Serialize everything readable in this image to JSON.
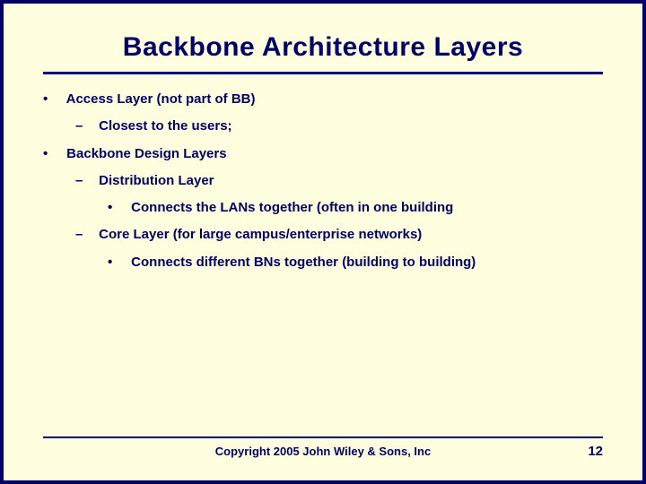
{
  "title": "Backbone Architecture Layers",
  "bullets": {
    "access_layer": "Access Layer (not part of BB)",
    "closest_users": "Closest to the users;",
    "backbone_design": "Backbone Design Layers",
    "dist_layer": "Distribution Layer",
    "connects_lans": "Connects the LANs together (often in one building",
    "core_layer": "Core Layer (for large campus/enterprise networks)",
    "connects_bns": "Connects different BNs together (building to building)"
  },
  "footer": {
    "copyright": "Copyright 2005 John Wiley & Sons, Inc",
    "page": "12"
  }
}
